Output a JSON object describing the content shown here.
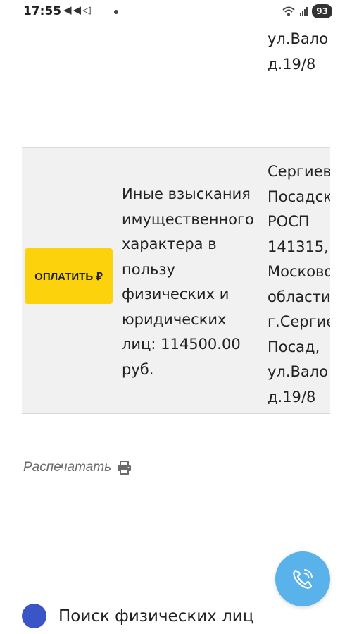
{
  "status_bar": {
    "time": "17:55",
    "notification_icons": "◀◀◁",
    "battery": "93"
  },
  "table": {
    "row_top": {
      "address_lines": [
        "ул.Вало",
        "д.19/8"
      ]
    },
    "row_main": {
      "pay_button_label": "ОПЛАТИТЬ ₽",
      "description_lines": [
        "Иные взыскания",
        "имущественного",
        "характера в",
        "пользу",
        "физических и",
        "юридических",
        "лиц: 114500.00",
        "руб."
      ],
      "department_lines": [
        "Сергиев",
        "Посадск",
        "РОСП",
        "141315,",
        "Москово",
        "области",
        "г.Сергие",
        "Посад,",
        "ул.Вало",
        "д.19/8"
      ]
    }
  },
  "print_link": {
    "label": "Распечатать",
    "icon": "printer-icon"
  },
  "call_button": {
    "icon": "phone-icon"
  },
  "list_item": {
    "label": "Поиск физических лиц"
  },
  "colors": {
    "pay_button": "#fcd20d",
    "call_button": "#5ab2ea",
    "list_dot": "#3a55c8",
    "row_background": "#f1f1f1"
  }
}
